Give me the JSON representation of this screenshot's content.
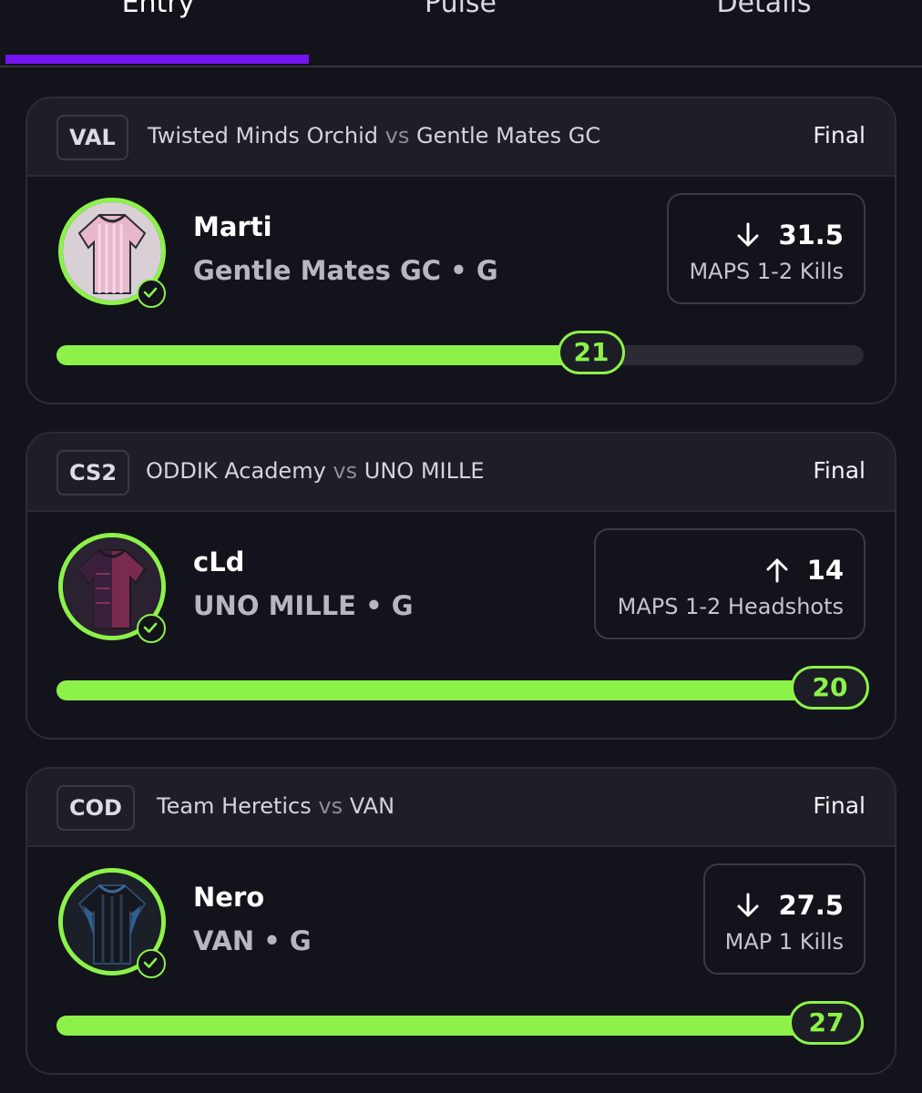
{
  "tabs": [
    {
      "label": "Entry",
      "active": true
    },
    {
      "label": "Pulse",
      "active": false
    },
    {
      "label": "Details",
      "active": false
    }
  ],
  "colors": {
    "accent": "#7413f0",
    "progress": "#8cf24a",
    "background": "#13131b"
  },
  "cards": [
    {
      "league": "VAL",
      "team_a": "Twisted Minds Orchid",
      "vs": "vs",
      "team_b": "Gentle Mates GC",
      "status": "Final",
      "player_name": "Marti",
      "player_team": "Gentle Mates GC • G",
      "direction_icon": "arrow-down-icon",
      "line": "31.5",
      "stat": "MAPS 1-2 Kills",
      "progress_value": "21",
      "progress_fraction": 0.67,
      "avatar_icon": "pink-jersey-icon"
    },
    {
      "league": "CS2",
      "team_a": "ODDIK Academy",
      "vs": "vs",
      "team_b": "UNO MILLE",
      "status": "Final",
      "player_name": "cLd",
      "player_team": "UNO MILLE • G",
      "direction_icon": "arrow-up-icon",
      "line": "14",
      "stat": "MAPS 1-2 Headshots",
      "progress_value": "20",
      "progress_fraction": 1.0,
      "avatar_icon": "maroon-jersey-icon"
    },
    {
      "league": "COD",
      "team_a": "Team Heretics",
      "vs": "vs",
      "team_b": "VAN",
      "status": "Final",
      "player_name": "Nero",
      "player_team": "VAN • G",
      "direction_icon": "arrow-down-icon",
      "line": "27.5",
      "stat": "MAP 1 Kills",
      "progress_value": "27",
      "progress_fraction": 1.0,
      "avatar_icon": "black-blue-jersey-icon"
    }
  ]
}
